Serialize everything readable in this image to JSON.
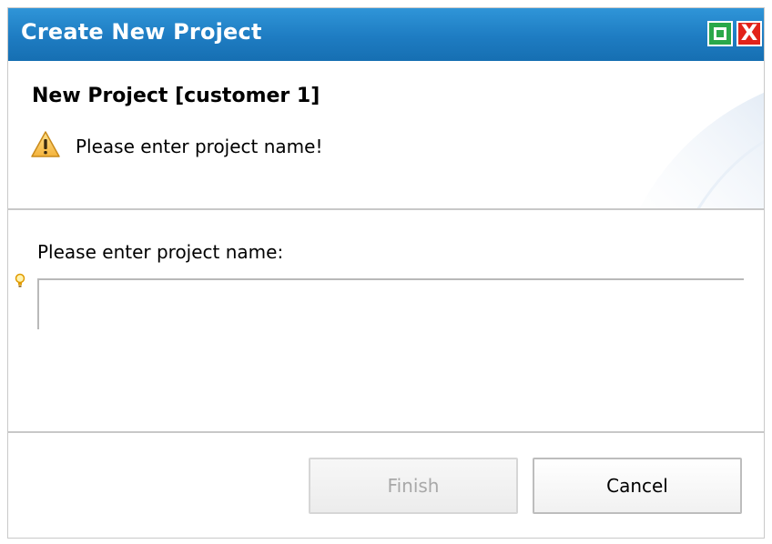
{
  "window": {
    "title": "Create New Project",
    "accent_color": "#1e7cc2"
  },
  "window_controls": {
    "maximize_icon": "maximize-icon",
    "close_icon": "close-icon",
    "close_glyph": "X"
  },
  "banner": {
    "title": "New Project [customer 1]",
    "warning_icon": "warning-icon",
    "warning_message": "Please enter project name!"
  },
  "form": {
    "project_name_label": "Please enter project name:",
    "project_name_value": "",
    "hint_icon": "lightbulb-icon"
  },
  "buttons": {
    "finish_label": "Finish",
    "finish_enabled": false,
    "cancel_label": "Cancel"
  }
}
